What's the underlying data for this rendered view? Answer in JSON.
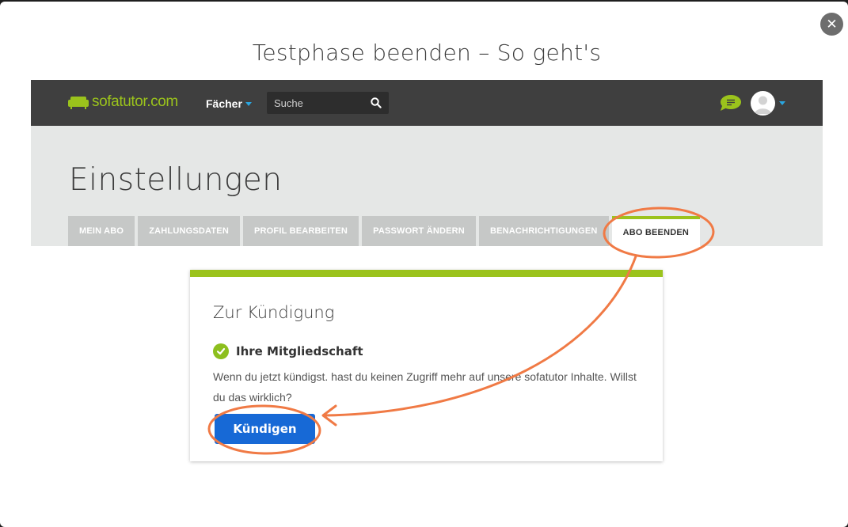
{
  "modal": {
    "title": "Testphase beenden – So geht's",
    "close_label": "✕"
  },
  "navbar": {
    "logo_text": "sofatutor.com",
    "subjects_label": "Fächer",
    "search_placeholder": "Suche"
  },
  "settings": {
    "heading": "Einstellungen",
    "tabs": [
      {
        "label": "MEIN ABO",
        "active": false
      },
      {
        "label": "ZAHLUNGSDATEN",
        "active": false
      },
      {
        "label": "PROFIL BEARBEITEN",
        "active": false
      },
      {
        "label": "PASSWORT ÄNDERN",
        "active": false
      },
      {
        "label": "BENACHRICHTIGUNGEN",
        "active": false
      },
      {
        "label": "ABO BEENDEN",
        "active": true
      }
    ]
  },
  "card": {
    "title": "Zur Kündigung",
    "membership_label": "Ihre Mitgliedschaft",
    "text": "Wenn du jetzt kündigst. hast du keinen Zugriff mehr auf unsere sofatutor Inhalte. Willst du das wirklich?",
    "button_label": "Kündigen"
  },
  "colors": {
    "brand_green": "#9bc31c",
    "button_blue": "#1769d6",
    "annotation_orange": "#f07a45",
    "navbar_bg": "#3f3f3f"
  }
}
